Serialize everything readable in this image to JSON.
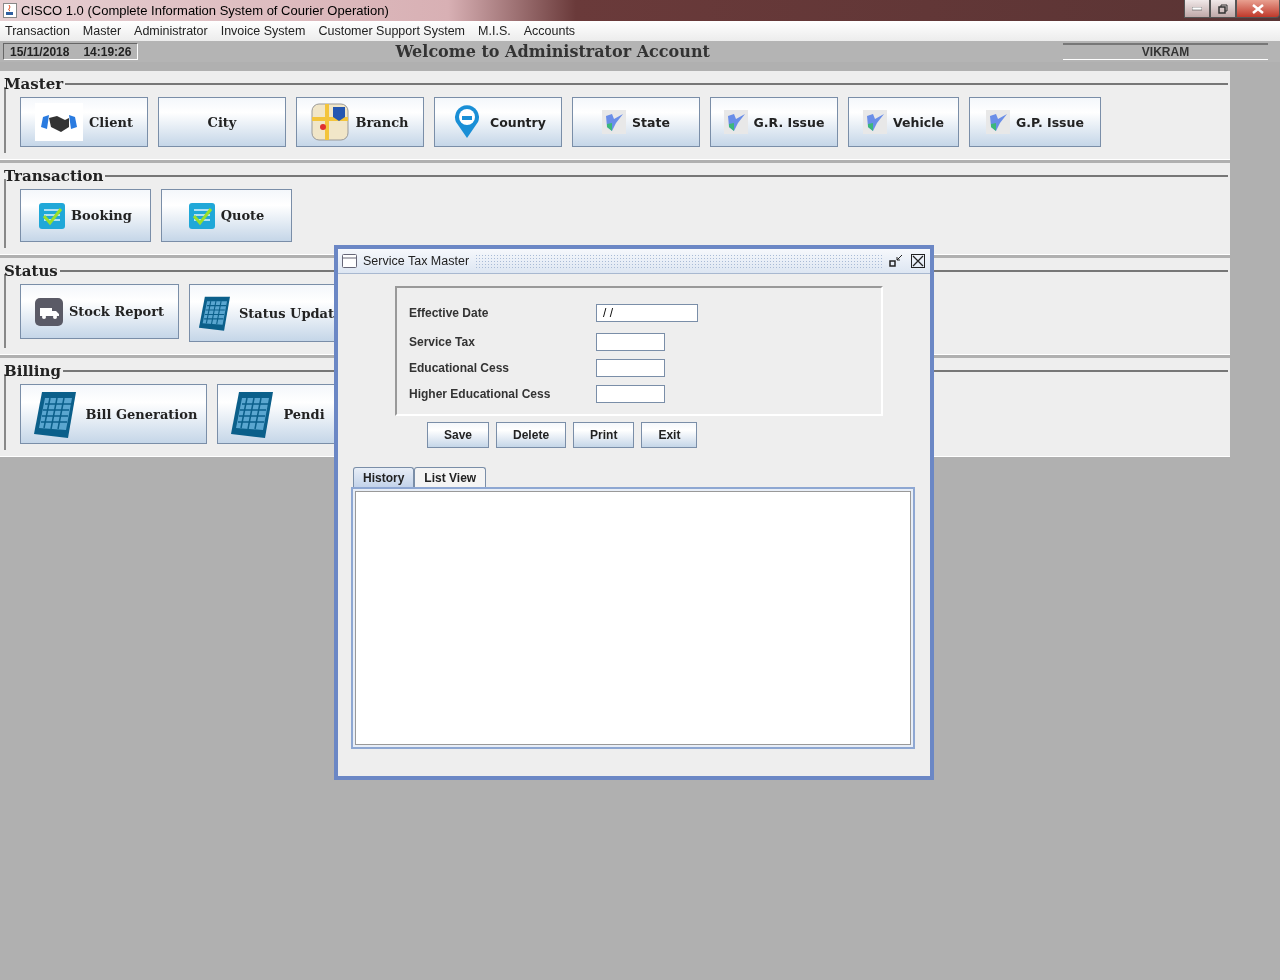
{
  "window": {
    "title": "CISCO 1.0 (Complete Information System of Courier Operation)"
  },
  "menu": [
    "Transaction",
    "Master",
    "Administrator",
    "Invoice System",
    "Customer Support System",
    "M.I.S.",
    "Accounts"
  ],
  "info": {
    "date": "15/11/2018",
    "time": "14:19:26",
    "welcome": "Welcome to Administrator Account",
    "user": "VIKRAM"
  },
  "sections": [
    {
      "title": "Master",
      "buttons": [
        {
          "label": "Client",
          "kind": "handshake"
        },
        {
          "label": "City",
          "kind": "plain"
        },
        {
          "label": "Branch",
          "kind": "map"
        },
        {
          "label": "Country",
          "kind": "pin"
        },
        {
          "label": "State",
          "kind": "flag"
        },
        {
          "label": "G.R. Issue",
          "kind": "flag"
        },
        {
          "label": "Vehicle",
          "kind": "flag"
        },
        {
          "label": "G.P. Issue",
          "kind": "flag"
        }
      ]
    },
    {
      "title": "Transaction",
      "buttons": [
        {
          "label": "Booking",
          "kind": "checklist"
        },
        {
          "label": "Quote",
          "kind": "checklist"
        }
      ]
    },
    {
      "title": "Status",
      "buttons": [
        {
          "label": "Stock Report",
          "kind": "truck"
        },
        {
          "label": "Status Updat",
          "kind": "calendar"
        }
      ]
    },
    {
      "title": "Billing",
      "buttons": [
        {
          "label": "Bill Generation",
          "kind": "calendar"
        },
        {
          "label": "Pendi",
          "kind": "calendar"
        }
      ]
    }
  ],
  "dialog": {
    "title": "Service Tax Master",
    "fields": [
      {
        "label": "Effective Date",
        "value": "/ /",
        "kind": "date"
      },
      {
        "label": "Service Tax",
        "kind": "short"
      },
      {
        "label": "Educational Cess",
        "kind": "short"
      },
      {
        "label": "Higher Educational Cess",
        "kind": "short"
      }
    ],
    "buttons": [
      "Save",
      "Delete",
      "Print",
      "Exit"
    ],
    "tabs": [
      {
        "label": "History",
        "selected": true
      },
      {
        "label": "List View",
        "selected": false
      }
    ]
  }
}
